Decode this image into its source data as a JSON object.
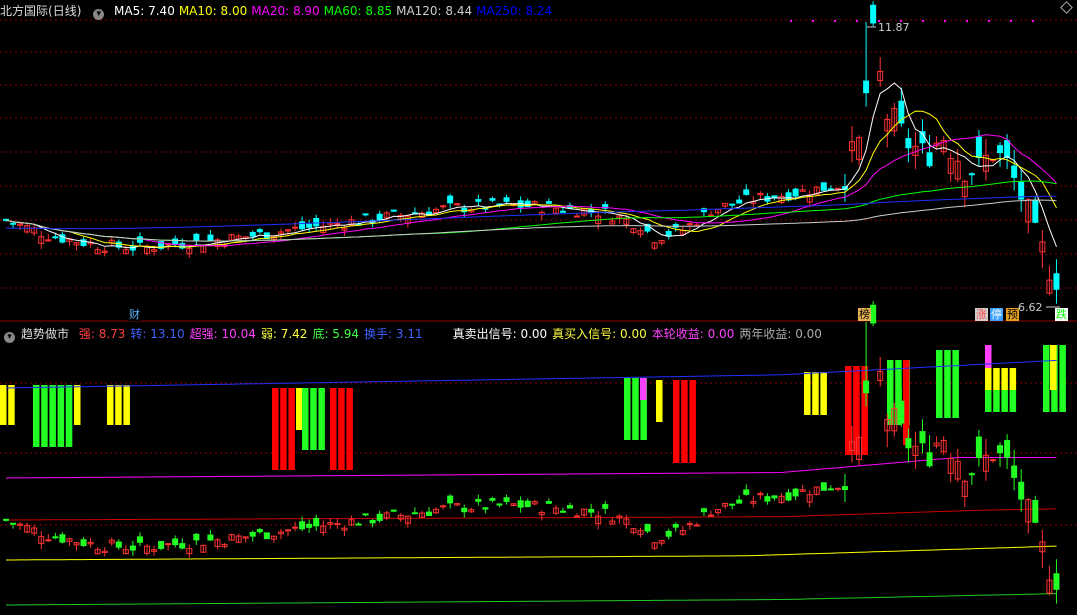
{
  "main_panel": {
    "stock_name": "北方国际",
    "period": "(日线)",
    "ma": [
      {
        "label": "MA5: ",
        "value": "7.40",
        "color": "#ffffff"
      },
      {
        "label": "MA10: ",
        "value": "8.00",
        "color": "#ffff00"
      },
      {
        "label": "MA20: ",
        "value": "8.90",
        "color": "#ff00ff"
      },
      {
        "label": "MA60: ",
        "value": "8.85",
        "color": "#00ff00"
      },
      {
        "label": "MA120: ",
        "value": "8.44",
        "color": "#cccccc"
      },
      {
        "label": "MA250: ",
        "value": "8.24",
        "color": "#0000ff"
      }
    ],
    "high_label": "11.87",
    "low_label": "6.62",
    "event_tags": [
      {
        "text": "财",
        "color": "#5ab4ff",
        "bg": "#000"
      },
      {
        "text": "榜",
        "color": "#000",
        "bg": "#e6b450"
      },
      {
        "text": "涨",
        "color": "#ff4040",
        "bg": "#d0d0d0"
      },
      {
        "text": "停",
        "color": "#fff",
        "bg": "#3aa0ff"
      },
      {
        "text": "预",
        "color": "#000",
        "bg": "#e6a020"
      },
      {
        "text": "跌",
        "color": "#00ff00",
        "bg": "#ffffff"
      }
    ]
  },
  "indicator_panel": {
    "name": "趋势做市",
    "items": [
      {
        "label": "强: ",
        "value": "8.73",
        "color": "#ff4040"
      },
      {
        "label": "转: ",
        "value": "13.10",
        "color": "#4060ff"
      },
      {
        "label": "超强: ",
        "value": "10.04",
        "color": "#ff40ff"
      },
      {
        "label": "弱: ",
        "value": "7.42",
        "color": "#ffff40"
      },
      {
        "label": "底: ",
        "value": "5.94",
        "color": "#40ff40"
      },
      {
        "label": "换手: ",
        "value": "3.11",
        "color": "#4060ff"
      },
      {
        "label": "真卖出信号: ",
        "value": "0.00",
        "color": "#ffffff"
      },
      {
        "label": "真买入信号: ",
        "value": "0.00",
        "color": "#ffff40"
      },
      {
        "label": "本轮收益: ",
        "value": "0.00",
        "color": "#ff40ff"
      },
      {
        "label": "两年收益: ",
        "value": "0.00",
        "color": "#aaaaaa"
      }
    ]
  },
  "colors": {
    "up": "#ff3232",
    "down": "#00ffff",
    "grid": "#8b0000"
  },
  "chart_data": {
    "type": "candlestick",
    "price_range": [
      6.62,
      11.87
    ],
    "y_axis_visible": false
  }
}
